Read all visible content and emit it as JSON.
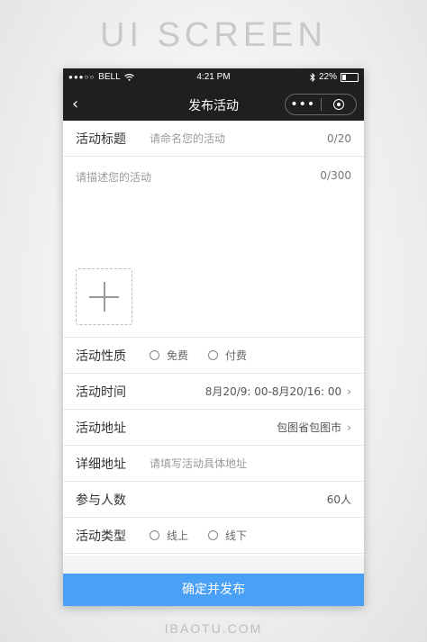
{
  "banner": "UI SCREEN",
  "footer": "IBAOTU.COM",
  "status_bar": {
    "carrier": "BELL",
    "signal_dots": "●●●○○",
    "time": "4:21 PM",
    "battery": "22%",
    "battery_level": 0.22
  },
  "navbar": {
    "back": "‹",
    "title": "发布活动",
    "more": "•••"
  },
  "form": {
    "title_label": "活动标题",
    "title_placeholder": "请命名您的活动",
    "title_counter": "0/20",
    "desc_placeholder": "请描述您的活动",
    "desc_counter": "0/300",
    "nature_label": "活动性质",
    "nature_options": [
      "免费",
      "付费"
    ],
    "time_label": "活动时间",
    "time_value": "8月20/9: 00-8月20/16: 00",
    "address_label": "活动地址",
    "address_value": "包图省包图市",
    "detail_label": "详细地址",
    "detail_placeholder": "请填写活动具体地址",
    "count_label": "参与人数",
    "count_value": "60人",
    "type_label": "活动类型",
    "type_options": [
      "线上",
      "线下"
    ]
  },
  "submit": "确定并发布"
}
